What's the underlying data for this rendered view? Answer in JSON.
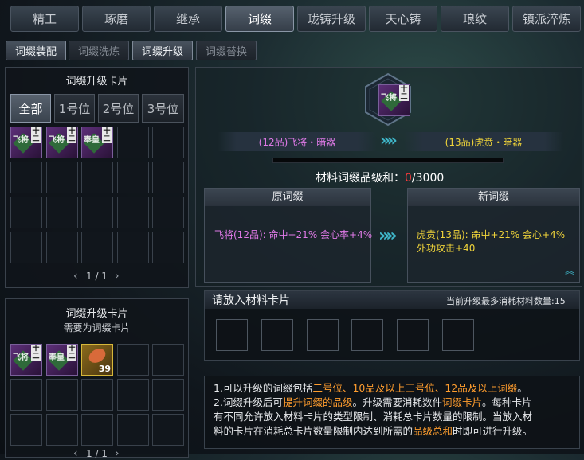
{
  "tabs": [
    "精工",
    "琢磨",
    "继承",
    "词缀",
    "珑铸升级",
    "天心铸",
    "琅纹",
    "镇派淬炼"
  ],
  "active_tab": "词缀",
  "subtabs": [
    "词缀装配",
    "词缀洗炼",
    "词缀升级",
    "词缀替换"
  ],
  "left_top": {
    "title": "词缀升级卡片",
    "filters": [
      "全部",
      "1号位",
      "2号位",
      "3号位"
    ],
    "cards": [
      {
        "text": "飞将",
        "grade": "十二"
      },
      {
        "text": "飞将",
        "grade": "十二"
      },
      {
        "text": "奉皇",
        "grade": "十二"
      }
    ],
    "pagination": "1 / 1",
    "prev": "‹",
    "next": "›"
  },
  "left_bottom": {
    "title": "词缀升级卡片",
    "subtitle": "需要为词缀卡片",
    "cards": [
      {
        "text": "飞将",
        "grade": "十二"
      },
      {
        "text": "奉皇",
        "grade": "十二"
      }
    ],
    "item_count": "39",
    "pagination": "1 / 1"
  },
  "upgrade": {
    "main_card_text": "飞将",
    "main_card_grade": "十二",
    "from_label": "(12品)飞将・暗器",
    "to_label": "(13品)虎贲・暗器",
    "material_label": "材料词缀品级和：",
    "material_current": "0",
    "material_total": "/3000",
    "old_title": "原词缀",
    "old_text": "飞将(12品): 命中+21% 会心率+4%",
    "new_title": "新词缀",
    "new_line1": "虎贲(13品): 命中+21% 会心+4%",
    "new_line2": "外功攻击+40"
  },
  "materials": {
    "title": "请放入材料卡片",
    "limit_label": "当前升级最多消耗材料数量:15"
  },
  "info": {
    "l1a": "1.可以升级的词缀包括",
    "l1b": "二号位、10品及以上三号位、12品及以上词缀",
    "l1c": "。",
    "l2a": "2.词缀升级后可",
    "l2b": "提升词缀的品级",
    "l2c": "。升级需要消耗数件",
    "l2d": "词缀卡片",
    "l2e": "。每种卡片",
    "l3": "有不同允许放入材料卡片的类型限制、消耗总卡片数量的限制。当放入材",
    "l4a": "料的卡片在消耗总卡片数量限制内达到所需的",
    "l4b": "品级总和",
    "l4c": "时即可进行升级。"
  },
  "colors": {
    "old_text": "#e07ae8",
    "new_text": "#f0d43a",
    "highlight": "#ff9d2e",
    "material_current": "#ff3b3b"
  }
}
